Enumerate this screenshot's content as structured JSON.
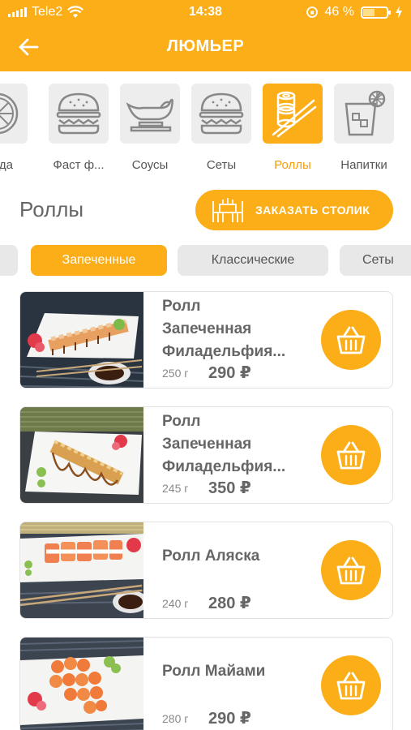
{
  "status_bar": {
    "carrier": "Tele2",
    "time": "14:38",
    "battery": "46 %",
    "battery_level": 0.46
  },
  "nav": {
    "title": "ЛЮМЬЕР"
  },
  "categories": [
    {
      "label": "да",
      "icon": "pizza-icon"
    },
    {
      "label": "Фаст ф...",
      "icon": "burger-icon"
    },
    {
      "label": "Соусы",
      "icon": "gravy-boat-icon"
    },
    {
      "label": "Сеты",
      "icon": "burger-icon"
    },
    {
      "label": "Роллы",
      "icon": "sushi-chopsticks-icon",
      "active": true
    },
    {
      "label": "Напитки",
      "icon": "drink-glass-icon"
    }
  ],
  "section": {
    "title": "Роллы",
    "order_button": "ЗАКАЗАТЬ СТОЛИК"
  },
  "subtabs": [
    {
      "label": "",
      "active": false
    },
    {
      "label": "Запеченные",
      "active": true
    },
    {
      "label": "Классические",
      "active": false
    },
    {
      "label": "Сеты",
      "active": false
    }
  ],
  "products": [
    {
      "name_line1": "Ролл",
      "name_line2": "Запеченная",
      "name_line3": "Филадельфия...",
      "weight": "250 г",
      "price": "290 ₽"
    },
    {
      "name_line1": "Ролл",
      "name_line2": "Запеченная",
      "name_line3": "Филадельфия...",
      "weight": "245 г",
      "price": "350 ₽"
    },
    {
      "name_line1": "Ролл Аляска",
      "weight": "240 г",
      "price": "280 ₽"
    },
    {
      "name_line1": "Ролл Майами",
      "weight": "280 г",
      "price": "290 ₽"
    }
  ],
  "colors": {
    "accent": "#FBAE17",
    "tile_bg": "#EDEDED",
    "text": "#666666"
  }
}
